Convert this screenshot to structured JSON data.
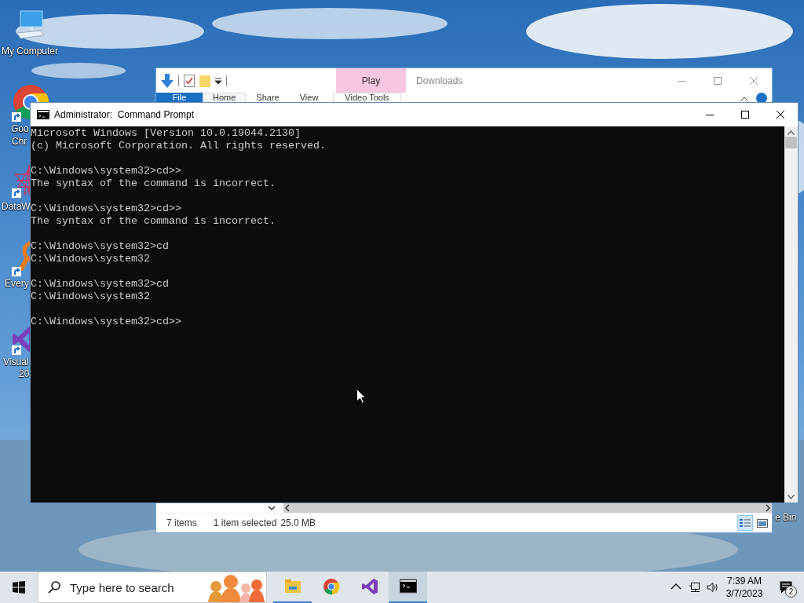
{
  "desktop_icons": [
    {
      "kind": "computer",
      "lines": [
        "My Computer"
      ],
      "shortcut": false
    },
    {
      "kind": "chrome",
      "lines": [
        "Goo",
        "Chr"
      ],
      "shortcut": true
    },
    {
      "kind": "star",
      "lines": [
        "DataW"
      ],
      "shortcut": true
    },
    {
      "kind": "magnifier",
      "lines": [
        "Every"
      ],
      "shortcut": true
    },
    {
      "kind": "studio",
      "lines": [
        "Visual",
        "20"
      ],
      "shortcut": true
    },
    {
      "kind": "bin",
      "lines": [
        "e Bin"
      ],
      "shortcut": false
    }
  ],
  "explorer": {
    "title": "Downloads",
    "contextual_tab": "Play",
    "contextual_group": "Video Tools",
    "tabs": [
      {
        "label": "File",
        "kind": "file",
        "selected": false
      },
      {
        "label": "Home",
        "kind": "tab",
        "selected": true
      },
      {
        "label": "Share",
        "kind": "tab",
        "selected": false
      },
      {
        "label": "View",
        "kind": "tab",
        "selected": false
      }
    ],
    "status": {
      "items": "7 items",
      "selection": "1 item selected",
      "size": "25.0 MB"
    },
    "views": [
      {
        "kind": "details",
        "selected": true
      },
      {
        "kind": "thumbnails",
        "selected": false
      }
    ]
  },
  "cmd": {
    "title": "Administrator:  Command Prompt",
    "blocks": [
      [
        "Microsoft Windows [Version 10.0.19044.2130]",
        "(c) Microsoft Corporation. All rights reserved."
      ],
      [
        "C:\\Windows\\system32>cd>>",
        "The syntax of the command is incorrect."
      ],
      [
        "C:\\Windows\\system32>cd>>",
        "The syntax of the command is incorrect."
      ],
      [
        "C:\\Windows\\system32>cd",
        "C:\\Windows\\system32"
      ],
      [
        "C:\\Windows\\system32>cd",
        "C:\\Windows\\system32"
      ],
      [
        "C:\\Windows\\system32>cd>>"
      ]
    ]
  },
  "taskbar": {
    "search": {
      "placeholder": "Type here to search"
    },
    "apps": [
      {
        "kind": "explorer",
        "running": true,
        "selected": false
      },
      {
        "kind": "chrome",
        "running": false,
        "selected": false
      },
      {
        "kind": "studio",
        "running": false,
        "selected": false
      },
      {
        "kind": "terminal",
        "running": true,
        "selected": true
      }
    ],
    "time": "7:39 AM",
    "date": "3/7/2023",
    "notifications": "2"
  }
}
